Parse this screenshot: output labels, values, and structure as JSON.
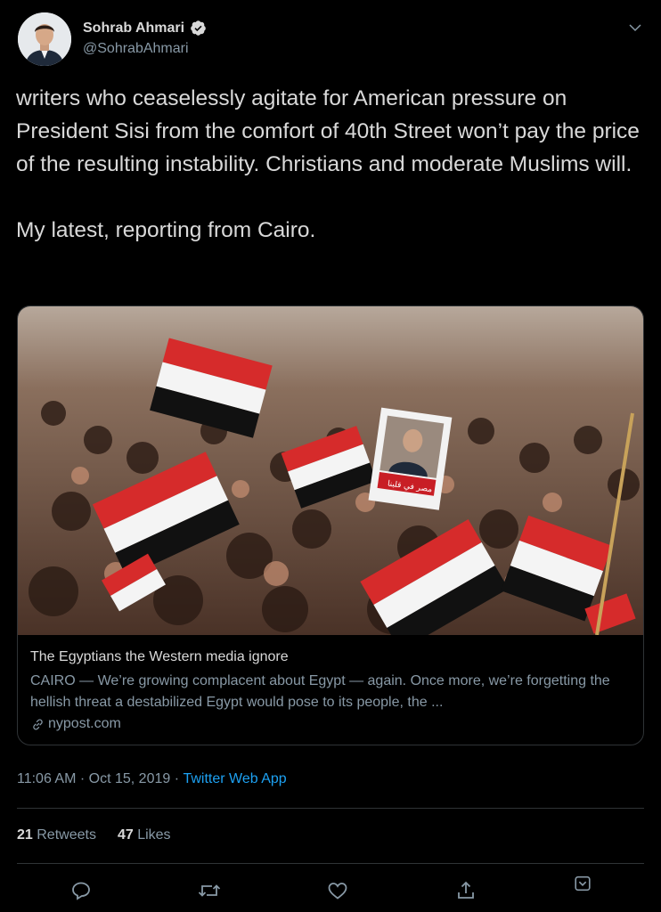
{
  "author": {
    "display_name": "Sohrab Ahmari",
    "handle": "@SohrabAhmari",
    "verified": true
  },
  "tweet": {
    "text": "writers who ceaselessly agitate for American pressure on President Sisi from the comfort of 40th Street won’t pay the price of the resulting instability. Christians and moderate Muslims will.\n\nMy latest, reporting from Cairo."
  },
  "card": {
    "title": "The Egyptians the Western media ignore",
    "description": "CAIRO — We’re growing complacent about Egypt — again. Once more, we’re forgetting the hellish threat a destabilized Egypt would pose to its people, the ...",
    "domain": "nypost.com",
    "image_icon": "crowd-photo",
    "poster_text": "ﻣﺼﺮ ﻓﻲ ﻗﻠﺒﻨﺎ"
  },
  "meta": {
    "time": "11:06 AM",
    "separator": " · ",
    "date": "Oct 15, 2019",
    "separator2": " · ",
    "app": "Twitter Web App"
  },
  "stats": {
    "retweets_count": "21",
    "retweets_label": "Retweets",
    "likes_count": "47",
    "likes_label": "Likes"
  },
  "icons": {
    "reply": "reply-icon",
    "retweet": "retweet-icon",
    "like": "heart-icon",
    "share": "share-icon",
    "bookmark": "bookmark-icon",
    "chevron": "chevron-down-icon"
  },
  "colors": {
    "background": "#000000",
    "text": "#d9d9d9",
    "secondary": "#8899a6",
    "accent": "#1da1f2",
    "border": "#2f3336"
  }
}
